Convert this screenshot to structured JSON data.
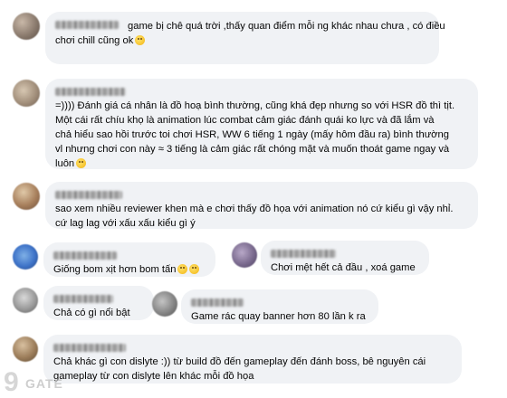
{
  "comments": [
    {
      "lines": [
        "game bị chê quá trời ,thấy quan điểm mỗi ng khác nhau chưa , có điều",
        "chơi chill cũng ok"
      ],
      "emoji": "smile-emoji"
    },
    {
      "lines": [
        "=)))) Đánh giá cá nhân là đồ hoạ bình thường, cũng khá đẹp nhưng so với HSR đồ thì tịt.",
        "Một cái rất chíu khọ là animation lúc combat cảm giác đánh quái ko lực và đã lắm và",
        "chả hiểu sao hồi trước toi chơi HSR, WW 6 tiếng 1 ngày (mấy hôm đầu ra) bình thường",
        "vl nhưng chơi con này ≈ 3 tiếng là cảm giác rất chóng mặt và muốn thoát game ngay và",
        "luôn"
      ],
      "emoji": "dizzy-emoji"
    },
    {
      "lines": [
        "sao xem nhiều reviewer khen mà e chơi thấy đồ họa với animation nó cứ kiểu gì vậy nhỉ.",
        "cứ lag lag với xấu xấu kiểu gì ý"
      ]
    },
    {
      "lines": [
        "Giống bom xịt hơn bom tấn"
      ],
      "emoji": "laugh-emoji"
    },
    {
      "lines": [
        "Chơi mệt hết cả đầu , xoá game"
      ]
    },
    {
      "lines": [
        "Chả có gì nổi bật"
      ]
    },
    {
      "lines": [
        "Game rác quay banner hơn 80 lần k ra"
      ]
    },
    {
      "lines": [
        "Chả khác gì con dislyte :)) từ build đồ đến gameplay đến đánh boss, bê nguyên cái",
        "gameplay từ con dislyte lên khác mỗi đồ họa"
      ]
    }
  ],
  "watermark": {
    "mark": "9",
    "text": "GATE"
  },
  "colors": {
    "bubble": "#f0f2f5",
    "text": "#050505"
  }
}
